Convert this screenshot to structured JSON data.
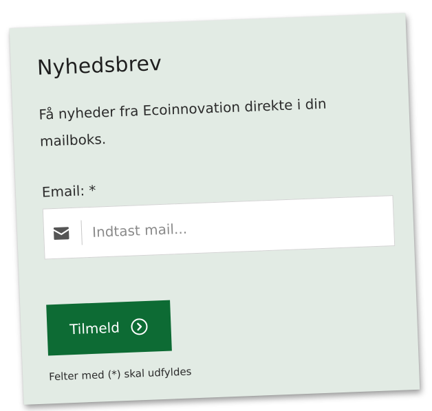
{
  "newsletter": {
    "title": "Nyhedsbrev",
    "description": "Få nyheder fra Ecoinnovation direkte i din mailboks.",
    "email_label": "Email: *",
    "email_placeholder": "Indtast mail...",
    "email_value": "",
    "submit_label": "Tilmeld",
    "required_note": "Felter med (*) skal udfyldes"
  },
  "icons": {
    "input_icon": "envelope-icon",
    "button_icon": "chevron-right-circle-icon"
  },
  "colors": {
    "card_background": "#e2ebe4",
    "button_background": "#0d6b34",
    "button_text": "#ffffff",
    "text": "#2b2b2b"
  }
}
